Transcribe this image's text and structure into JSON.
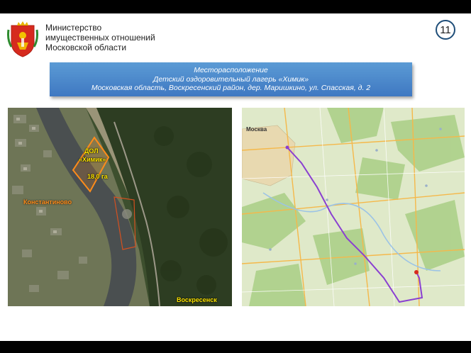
{
  "header": {
    "ministry_lines": [
      "Министерство",
      "имущественных отношений",
      "Московской области"
    ],
    "page_number": "11"
  },
  "banner": {
    "lines": [
      "Месторасположение",
      "Детский оздоровительный лагерь «Химик»",
      "Московская область, Воскресенский район, дер. Маришкино, ул. Спасская, д. 2"
    ]
  },
  "satellite": {
    "camp_label_1": "ДОЛ",
    "camp_label_2": "«Химик»",
    "area_label": "18,0 га",
    "village_label": "Константиново",
    "town_label": "Воскресенск"
  },
  "road_map": {
    "city_label": "Москва"
  },
  "colors": {
    "banner": "#4a86c8",
    "route": "#8a3fd1",
    "highlight": "#ff8c1a",
    "label": "#ffe600"
  }
}
